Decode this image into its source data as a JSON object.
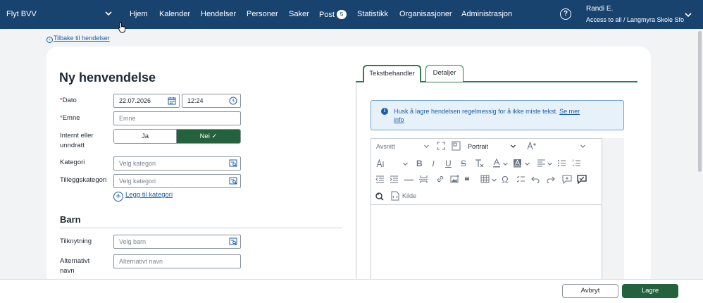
{
  "topbar": {
    "brand": "Flyt BVV",
    "nav": [
      {
        "label": "Hjem"
      },
      {
        "label": "Kalender"
      },
      {
        "label": "Hendelser"
      },
      {
        "label": "Personer"
      },
      {
        "label": "Saker"
      },
      {
        "label": "Post",
        "badge": "5"
      },
      {
        "label": "Statistikk"
      },
      {
        "label": "Organisasjoner"
      },
      {
        "label": "Administrasjon"
      }
    ],
    "help_icon": "?",
    "user": {
      "name": "Randi E.",
      "access": "Access to all / Langmyra Skole Sfo"
    }
  },
  "back_link": "Tilbake til hendelser",
  "page_title": "Ny henvendelse",
  "form": {
    "dato": {
      "required_mark": "*",
      "label": "Dato",
      "date": "22.07.2026",
      "time": "12:24"
    },
    "emne": {
      "required_mark": "*",
      "label": "Emne",
      "placeholder": "Emne"
    },
    "internt": {
      "label": "Internt eller unndratt",
      "yes": "Ja",
      "no": "Nei ✓",
      "selected": "Nei"
    },
    "kategori": {
      "label": "Kategori",
      "placeholder": "Velg kategori"
    },
    "tilleggskategori": {
      "label": "Tilleggskategori",
      "placeholder": "Velg kategori"
    },
    "add_category": "Legg til kategori"
  },
  "barn": {
    "section_title": "Barn",
    "tilknytning": {
      "label": "Tilknytning",
      "placeholder": "Velg barn"
    },
    "alternativt": {
      "label": "Alternativt navn",
      "placeholder": "Alternativt navn"
    }
  },
  "tabs": [
    {
      "label": "Tekstbehandler",
      "active": true
    },
    {
      "label": "Detaljer",
      "active": false
    }
  ],
  "info": {
    "text": "Husk å lagre hendelsen regelmessig for å ikke miste tekst.",
    "link": "Se mer info"
  },
  "editor": {
    "paragraph_format": "Avsnitt",
    "page_orientation": "Portrait",
    "source_label": "Kilde"
  },
  "footer": {
    "cancel": "Avbryt",
    "save": "Lagre"
  },
  "colors": {
    "nav_bg": "#19436f",
    "accent_green": "#24613d",
    "link_blue": "#1b5ea8",
    "info_bg": "#e6f1fa"
  }
}
